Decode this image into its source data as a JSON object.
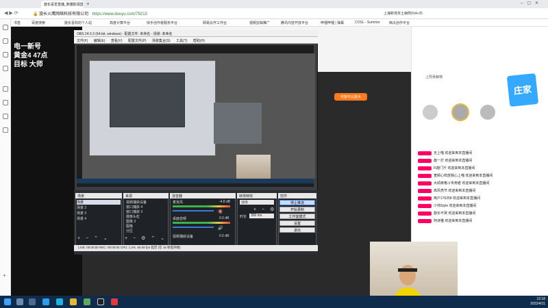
{
  "browser": {
    "tab_title": "旋长喜爱直播_熊猫影视直播_斗鱼直播",
    "url_prefix": "旋长火鹰网络科技有限公司",
    "url": "https://www.douyu.com/79213",
    "top_right_text": "上海新增本土病例914+25",
    "bookmarks": [
      "书签",
      "百度搜索",
      "旋长喜欢的个人站",
      "高度计算平台",
      "快手创作者服务平台",
      "网易云开工作台",
      "视频剪辑推广",
      "腾讯内容开放平台",
      "哔哩哔哩 | 弹幕",
      "COSL - Summer",
      "西瓜创作平台"
    ]
  },
  "overlay": {
    "line1": "电一新号",
    "line2": "黄金4 47点",
    "line3": "目标 大师"
  },
  "obs": {
    "title": "OBS 24.0.3 (64-bit, windows) - 配置文件: 未命名 - 场景: 未命名",
    "menu": [
      "文件(F)",
      "编辑(E)",
      "查看(V)",
      "配置文件(P)",
      "场景集合(S)",
      "工具(T)",
      "帮助(H)"
    ],
    "docks": {
      "scenes": {
        "title": "场景",
        "items": [
          "场景",
          "场景 2",
          "场景 3",
          "场景 4"
        ]
      },
      "sources": {
        "title": "来源",
        "items": [
          "视频捕获设备",
          "窗口捕获 4",
          "窗口捕获 3",
          "摄像头粒",
          "图像 3",
          "图像",
          "分区"
        ]
      },
      "mixer": {
        "title": "混音器",
        "tracks": [
          {
            "name": "麦克风",
            "db": "-4.8 dB"
          },
          {
            "name": "桌面音频",
            "db": "0.0 dB"
          },
          {
            "name": "视频捕获设备",
            "db": "0.0 dB"
          }
        ]
      },
      "transitions": {
        "title": "转场特效",
        "type": "淡出",
        "duration_label": "时长",
        "duration": "300 ms"
      },
      "controls": {
        "title": "控件",
        "buttons": [
          "停止推流",
          "开始录制",
          "工作室模式",
          "设置",
          "退出"
        ]
      }
    },
    "status": "LIVE: 00:00:00   REC: 00:00:00   CPU: 1.2%, 60.00 fps   延迟 (在 15 秒后开始)"
  },
  "page": {
    "orange_button": "可能可以放大",
    "ad_text": "庄家",
    "rank_title": "上周贡献榜",
    "rank_rows": [
      "无上喵 欢迎来到本直播间",
      "旋一打 欢迎来到本直播间",
      "Fi旋门斤 欢迎来到本直播间",
      "宽频心鸣放我心上喵 欢迎来到本直播间",
      "大顽疾格斗专用者 欢迎来到本直播间",
      "高风亮节 欢迎来到本直播间",
      "用户176258 欢迎来到本直播间",
      "少帅Style 欢迎来到本直播间",
      "旋长不哭 欢迎来到本直播间",
      "阿诗猫 欢迎来到本直播间"
    ]
  },
  "taskbar": {
    "time": "12:18",
    "date": "2022/4/11"
  }
}
